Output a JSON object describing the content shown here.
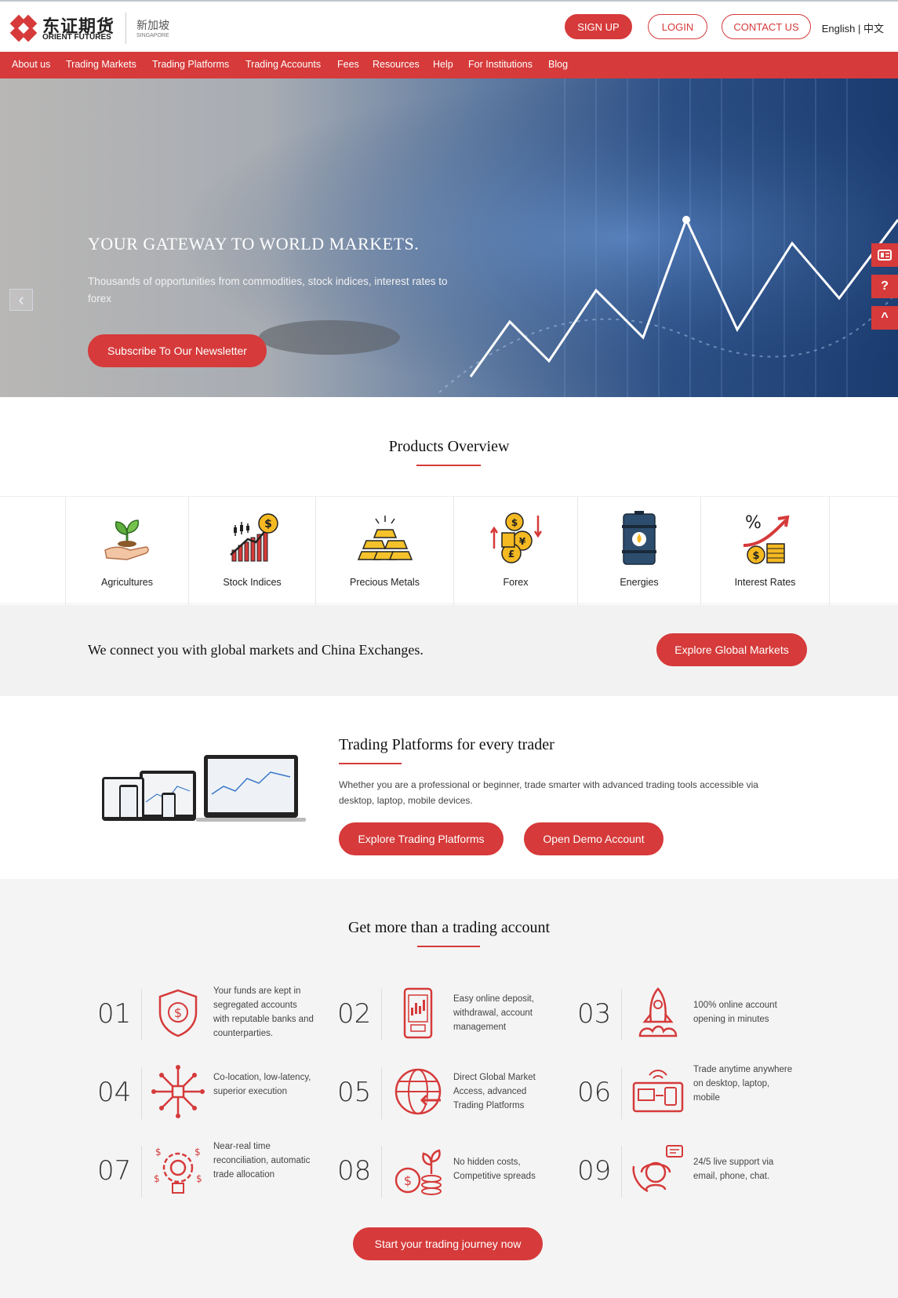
{
  "brand": {
    "name_cn": "东证期货",
    "name_en": "ORIENT FUTURES",
    "region_cn": "新加坡",
    "region_en": "SINGAPORE",
    "accent": "#d63a3a"
  },
  "header": {
    "signup": "SIGN UP",
    "login": "LOGIN",
    "contact": "CONTACT US",
    "lang_en": "English",
    "lang_sep": " | ",
    "lang_cn": "中文"
  },
  "nav": [
    "About us",
    "Trading Markets",
    "Trading Platforms",
    "Trading Accounts",
    "Fees",
    "Resources",
    "Help",
    "For Institutions",
    "Blog"
  ],
  "hero": {
    "title": "YOUR GATEWAY TO WORLD MARKETS.",
    "subtitle": "Thousands of opportunities from commodities, stock indices, interest rates to forex",
    "button": "Subscribe To Our Newsletter",
    "prev_icon": "chevron-left-icon"
  },
  "side_tabs": [
    "card-icon",
    "help-icon",
    "chevron-up-icon"
  ],
  "products": {
    "title": "Products Overview",
    "items": [
      "Agricultures",
      "Stock Indices",
      "Precious Metals",
      "Forex",
      "Energies",
      "Interest Rates"
    ]
  },
  "connect": {
    "text": "We connect you with global markets and China Exchanges.",
    "button": "Explore Global Markets"
  },
  "platforms": {
    "title": "Trading Platforms for every trader",
    "text": "Whether you are a professional or beginner, trade smarter with advanced trading tools accessible via desktop, laptop, mobile devices.",
    "button1": "Explore Trading Platforms",
    "button2": "Open Demo Account"
  },
  "benefits": {
    "title": "Get more than a trading account",
    "items": [
      {
        "num": "01",
        "text": "Your funds are kept in segregated accounts with reputable banks and counterparties.",
        "icon": "shield-dollar-icon"
      },
      {
        "num": "02",
        "text": "Easy online deposit, withdrawal, account management",
        "icon": "mobile-chart-icon"
      },
      {
        "num": "03",
        "text": "100% online account opening in minutes",
        "icon": "rocket-icon"
      },
      {
        "num": "04",
        "text": "Co-location, low-latency, superior execution",
        "icon": "network-icon"
      },
      {
        "num": "05",
        "text": "Direct Global Market Access, advanced Trading Platforms",
        "icon": "globe-arrow-icon"
      },
      {
        "num": "06",
        "text": "Trade anytime anywhere on desktop, laptop, mobile",
        "icon": "devices-icon"
      },
      {
        "num": "07",
        "text": "Near-real time reconciliation, automatic trade allocation",
        "icon": "gear-bulb-icon"
      },
      {
        "num": "08",
        "text": "No hidden costs, Competitive spreads",
        "icon": "coin-plant-icon"
      },
      {
        "num": "09",
        "text": "24/5 live support via email, phone, chat.",
        "icon": "support-icon"
      }
    ],
    "cta": "Start your trading journey now"
  }
}
